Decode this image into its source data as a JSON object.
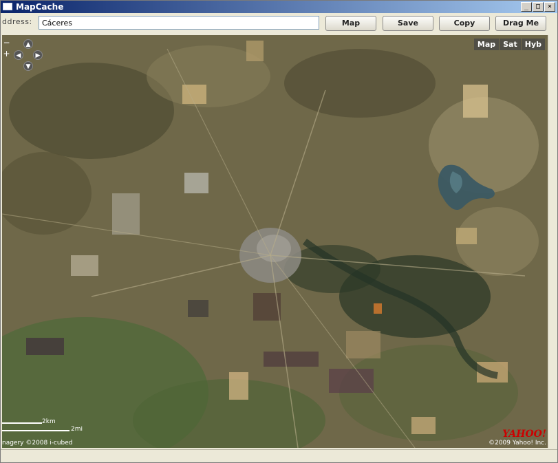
{
  "window": {
    "title": "MapCache",
    "minimize_label": "_",
    "maximize_label": "□",
    "close_label": "×"
  },
  "toolbar": {
    "address_label": "ddress:",
    "address_value": "Cáceres",
    "buttons": [
      "Map",
      "Save",
      "Copy",
      "Drag Me"
    ]
  },
  "map": {
    "zoom_in": "+",
    "zoom_out": "−",
    "nav_up": "▲",
    "nav_down": "▼",
    "nav_left": "◀",
    "nav_right": "▶",
    "modes": [
      "Map",
      "Sat",
      "Hyb"
    ],
    "scale_km": "2km",
    "scale_mi": "2mi",
    "imagery_credit": "nagery ©2008 i-cubed",
    "brand": "YAHOO!",
    "copyright": "©2009 Yahoo! Inc."
  },
  "colors": {
    "title_gradient_start": "#0a246a",
    "title_gradient_end": "#a6caf0",
    "map_base": "#6e6646"
  }
}
